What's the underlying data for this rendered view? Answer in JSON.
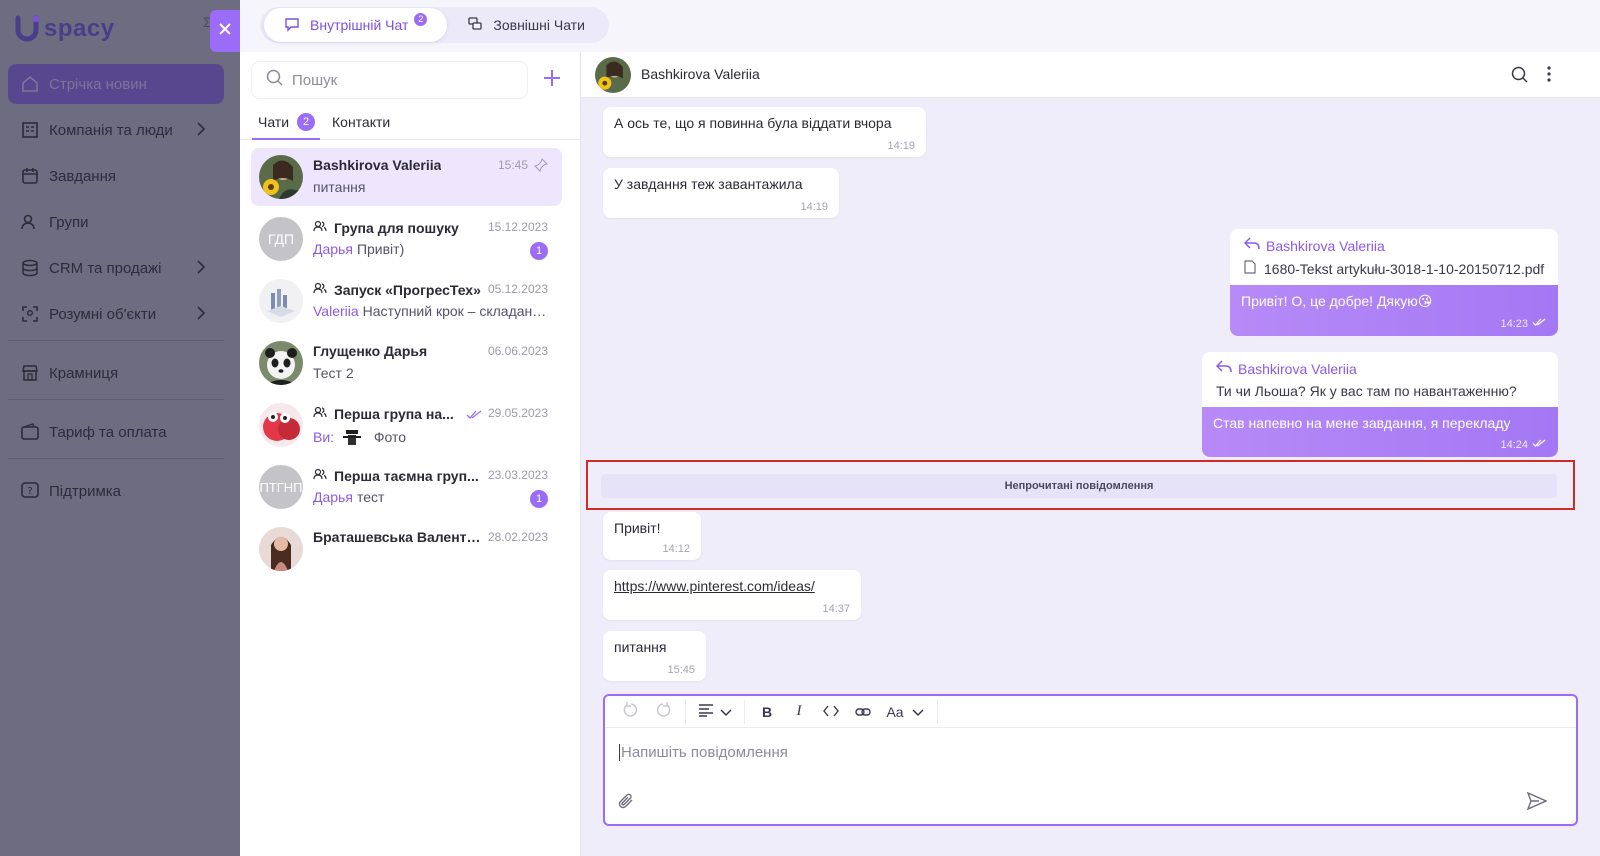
{
  "brand": {
    "name": "spacy",
    "extra": "Σ"
  },
  "nav": [
    {
      "label": "Стрічка новин",
      "icon": "home-icon",
      "active": true,
      "chevron": false
    },
    {
      "label": "Компанія та люди",
      "icon": "building-icon",
      "chevron": true
    },
    {
      "label": "Завдання",
      "icon": "calendar-icon",
      "chevron": false
    },
    {
      "label": "Групи",
      "icon": "users-icon",
      "chevron": false
    },
    {
      "label": "CRM та продажі",
      "icon": "database-icon",
      "chevron": true
    },
    {
      "label": "Розумні об'єкти",
      "icon": "scan-icon",
      "chevron": true
    },
    {
      "label": "Крамниця",
      "icon": "store-icon",
      "chevron": false
    },
    {
      "label": "Тариф та оплата",
      "icon": "wallet-icon",
      "chevron": false
    },
    {
      "label": "Підтримка",
      "icon": "help-icon",
      "chevron": false
    }
  ],
  "top_tabs": {
    "internal": {
      "label": "Внутрішній Чат",
      "badge": "2"
    },
    "external": {
      "label": "Зовнішні Чати"
    }
  },
  "chatlist": {
    "search_placeholder": "Пошук",
    "tab_chats": "Чати",
    "tab_chats_count": "2",
    "tab_contacts": "Контакти",
    "items": [
      {
        "name": "Bashkirova Valeriia",
        "date": "15:45",
        "preview": "питання",
        "who": "",
        "group": false,
        "pinned": true,
        "active": true
      },
      {
        "name": "Група для пошуку",
        "date": "15.12.2023",
        "who": "Дарья",
        "preview": "Привіт)",
        "group": true,
        "initials": "ГДП",
        "badge": "1"
      },
      {
        "name": "Запуск «ПрогресТех»",
        "date": "05.12.2023",
        "who": "Valeriia",
        "preview": "Наступний крок – складанн...",
        "group": true
      },
      {
        "name": "Глущенко Дарья",
        "date": "06.06.2023",
        "who": "",
        "preview": "Тест 2",
        "group": false
      },
      {
        "name": "Перша група на...",
        "date": "29.05.2023",
        "who": "Ви:",
        "preview": "Фото",
        "group": true,
        "read": true
      },
      {
        "name": "Перша таємна груп...",
        "date": "23.03.2023",
        "who": "Дарья",
        "preview": "тест",
        "group": true,
        "initials": "ПТГНП",
        "badge": "1"
      },
      {
        "name": "Браташевська Валенти...",
        "date": "28.02.2023",
        "who": "",
        "preview": "",
        "group": false
      }
    ]
  },
  "conversation": {
    "title": "Bashkirova Valeriia",
    "messages": [
      {
        "text": "А ось те, що я повинна була віддати вчора",
        "time": "14:19"
      },
      {
        "text": "У завдання теж завантажила",
        "time": "14:19"
      },
      {
        "reply_author": "Bashkirova Valeriia",
        "reply_file": "1680-Tekst artykułu-3018-1-10-20150712.pdf",
        "text": "Привіт! О, це добре! Дякую😘",
        "time": "14:23"
      },
      {
        "reply_author": "Bashkirova Valeriia",
        "reply_text": "Ти чи Льоша? Як у вас там по навантаженню?",
        "text": "Став напевно на мене завдання, я перекладу",
        "time": "14:24"
      },
      {
        "text": "Привіт!",
        "time": "14:12"
      },
      {
        "text": "https://www.pinterest.com/ideas/",
        "time": "14:37"
      },
      {
        "text": "питання",
        "time": "15:45"
      }
    ],
    "unread_label": "Непрочитані повідомлення"
  },
  "composer": {
    "placeholder": "Напишіть повідомлення",
    "font_label": "Aa"
  },
  "colors": {
    "accent": "#9b6cf7",
    "highlight": "#d12b24"
  }
}
